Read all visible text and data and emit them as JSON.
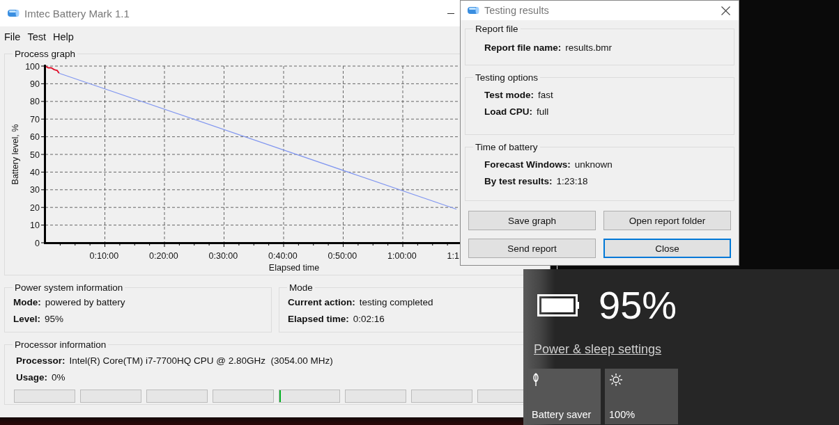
{
  "main_window": {
    "title": "Imtec Battery Mark 1.1",
    "menu": [
      "File",
      "Test",
      "Help"
    ],
    "process_graph": {
      "title": "Process graph",
      "chart_data": {
        "type": "line",
        "xlabel": "Elapsed time",
        "ylabel": "Battery level, %",
        "x": [
          0,
          0.5,
          1,
          1.5,
          2,
          2.3,
          69
        ],
        "series": [
          {
            "color": "#e0102a",
            "values": [
              100,
              99,
              99,
              98,
              97.5,
              96,
              null
            ]
          },
          {
            "color": "#8096f0",
            "values": [
              null,
              null,
              null,
              null,
              null,
              96,
              19
            ]
          }
        ],
        "xlim": [
          0,
          70
        ],
        "ylim": [
          0,
          100
        ],
        "grid": true,
        "xticks": [
          {
            "value": 10,
            "label": "0:10:00"
          },
          {
            "value": 20,
            "label": "0:20:00"
          },
          {
            "value": 30,
            "label": "0:30:00"
          },
          {
            "value": 40,
            "label": "0:40:00"
          },
          {
            "value": 50,
            "label": "0:50:00"
          },
          {
            "value": 60,
            "label": "1:00:00"
          },
          {
            "value": 70,
            "label": "1:1"
          }
        ],
        "yticks": [
          0,
          10,
          20,
          30,
          40,
          50,
          60,
          70,
          80,
          90,
          100
        ]
      }
    },
    "power_system_information": {
      "title": "Power system information",
      "fields": [
        {
          "label": "Mode:",
          "value": "powered by battery"
        },
        {
          "label": "Level:",
          "value": "95%"
        }
      ]
    },
    "mode": {
      "title": "Mode",
      "fields": [
        {
          "label": "Current action:",
          "value": "testing completed"
        },
        {
          "label": "Elapsed time:",
          "value": "0:02:16"
        }
      ]
    },
    "processor_information": {
      "title": "Processor information",
      "fields": [
        {
          "label": "Processor:",
          "value": "Intel(R) Core(TM) i7-7700HQ CPU @ 2.80GHz  (3054.00 MHz)"
        },
        {
          "label": "Usage:",
          "value": "0%"
        }
      ],
      "core_meters": [
        {
          "level": 0
        },
        {
          "level": 0
        },
        {
          "level": 0
        },
        {
          "level": 0
        },
        {
          "level": 0.02
        },
        {
          "level": 0
        },
        {
          "level": 0
        },
        {
          "level": 0
        }
      ]
    }
  },
  "testing_results_dialog": {
    "title": "Testing results",
    "groups": [
      {
        "title": "Report file",
        "fields": [
          {
            "label": "Report file name:",
            "value": "results.bmr"
          }
        ]
      },
      {
        "title": "Testing options",
        "fields": [
          {
            "label": "Test mode:",
            "value": "fast"
          },
          {
            "label": "Load CPU:",
            "value": "full"
          }
        ]
      },
      {
        "title": "Time of battery",
        "fields": [
          {
            "label": "Forecast Windows:",
            "value": "unknown"
          },
          {
            "label": "By test results:",
            "value": "1:23:18"
          }
        ]
      }
    ],
    "buttons": [
      {
        "label": "Save graph",
        "focused": false
      },
      {
        "label": "Open report folder",
        "focused": false
      },
      {
        "label": "Send report",
        "focused": false
      },
      {
        "label": "Close",
        "focused": true
      }
    ]
  },
  "battery_flyout": {
    "percent": "95%",
    "link": "Power & sleep settings",
    "tiles": [
      {
        "label": "Battery saver",
        "kind": "battery-saver"
      },
      {
        "label": "100%",
        "kind": "brightness"
      }
    ]
  }
}
